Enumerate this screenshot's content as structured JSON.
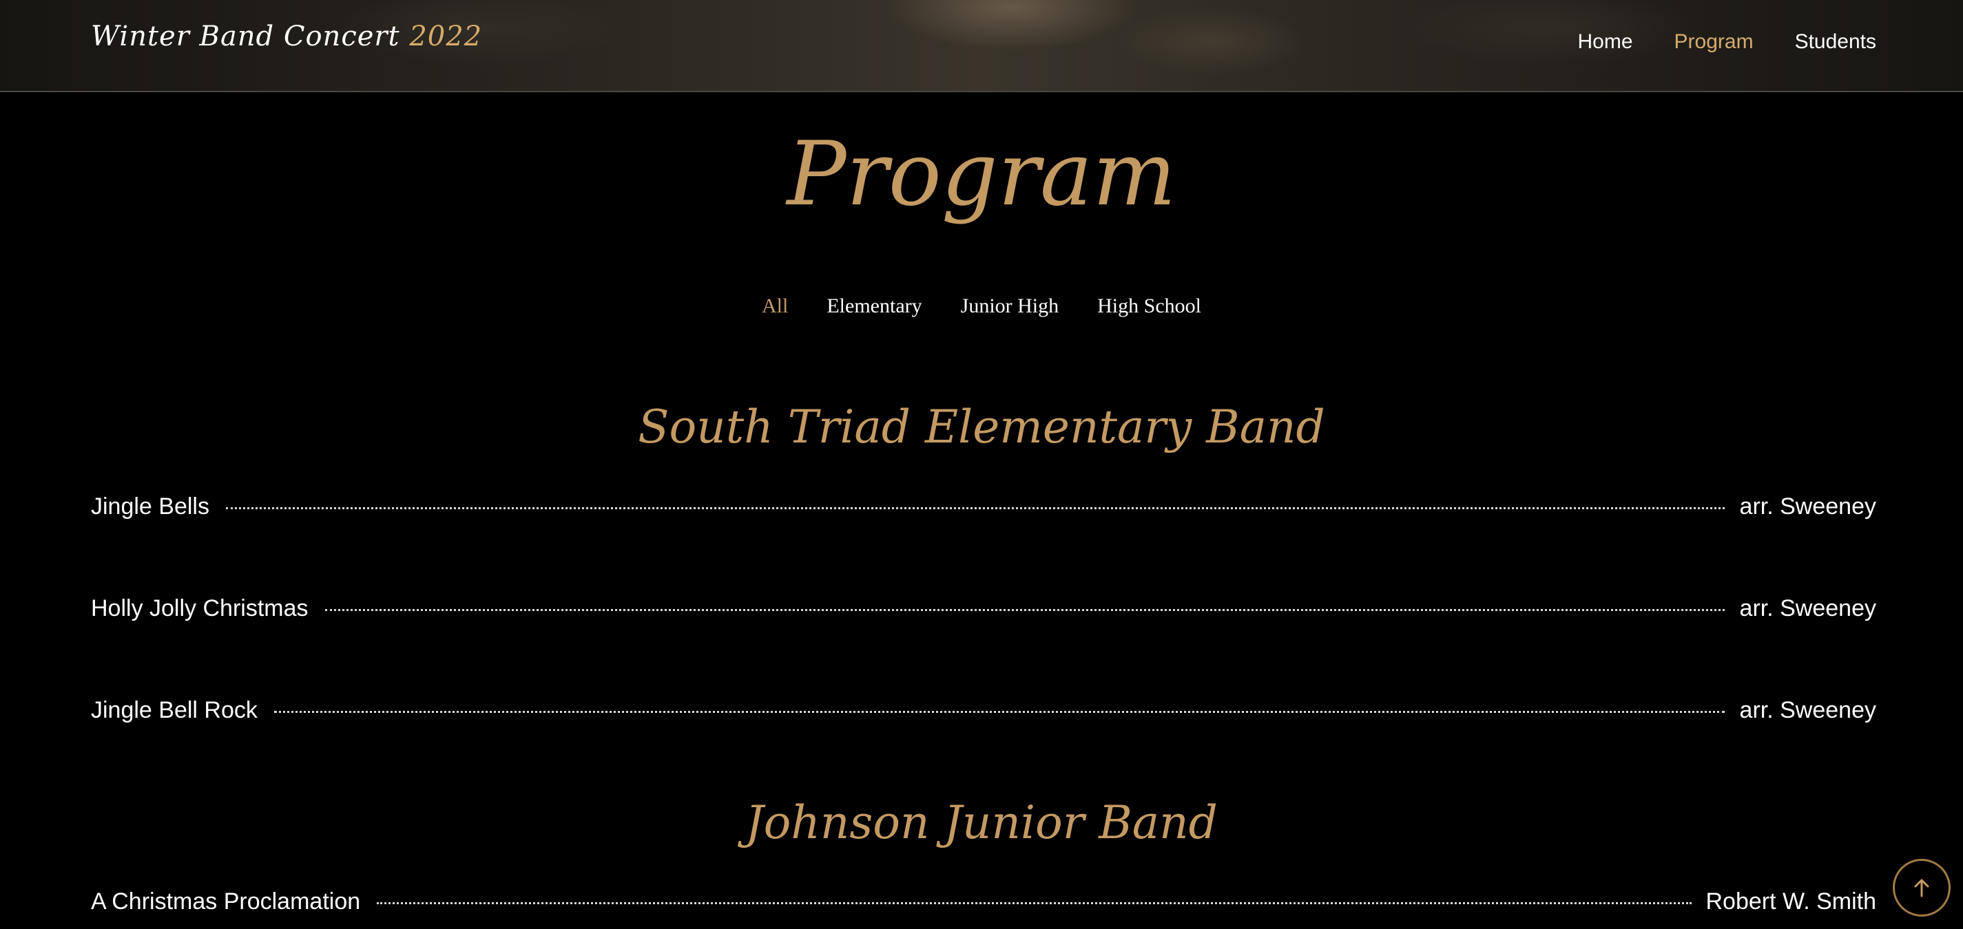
{
  "header": {
    "brand_name": "Winter Band Concert",
    "brand_year": "2022",
    "nav": [
      {
        "label": "Home",
        "active": false
      },
      {
        "label": "Program",
        "active": true
      },
      {
        "label": "Students",
        "active": false
      }
    ]
  },
  "page": {
    "title": "Program"
  },
  "filters": [
    {
      "label": "All",
      "active": true
    },
    {
      "label": "Elementary",
      "active": false
    },
    {
      "label": "Junior High",
      "active": false
    },
    {
      "label": "High School",
      "active": false
    }
  ],
  "sections": [
    {
      "title": "South Triad Elementary Band",
      "pieces": [
        {
          "title": "Jingle Bells",
          "credit": "arr. Sweeney"
        },
        {
          "title": "Holly Jolly Christmas",
          "credit": "arr. Sweeney"
        },
        {
          "title": "Jingle Bell Rock",
          "credit": "arr. Sweeney"
        }
      ]
    },
    {
      "title": "Johnson Junior Band",
      "pieces": [
        {
          "title": "A Christmas Proclamation",
          "credit": "Robert W. Smith"
        }
      ]
    }
  ],
  "colors": {
    "accent": "#c49a63",
    "background": "#000000",
    "text": "#ffffff"
  },
  "icons": {
    "back_to_top": "arrow-up-icon"
  }
}
